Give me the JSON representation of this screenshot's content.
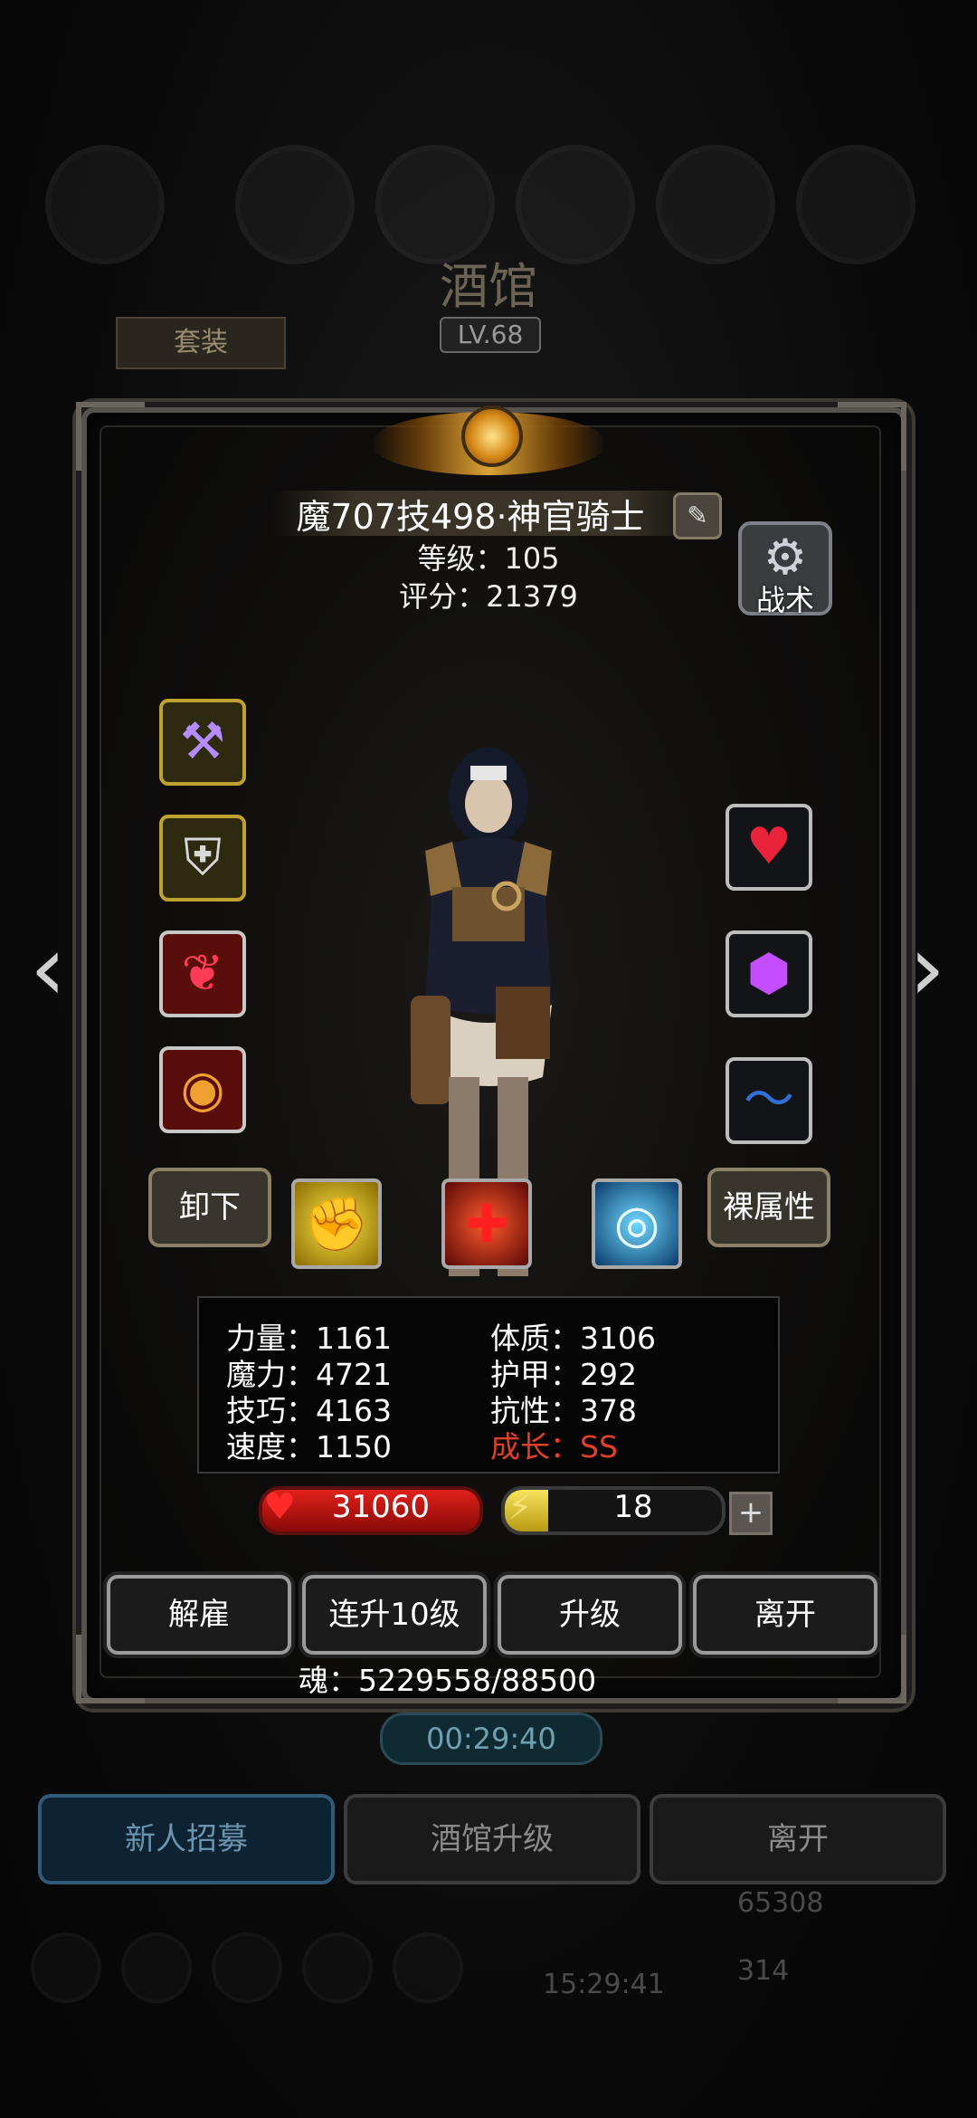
{
  "background": {
    "title": "酒馆",
    "level": "LV.68",
    "tag_button": "套装",
    "timer": "00:29:40",
    "bottom_buttons": [
      "新人招募",
      "酒馆升级",
      "离开"
    ],
    "gold": "65308",
    "gems": "314",
    "clock": "15:29:41"
  },
  "hero": {
    "name": "魔707技498·神官骑士",
    "level_text": "等级：105",
    "score_text": "评分：21379",
    "tactic_label": "战术"
  },
  "equipment": {
    "left_slots": [
      "mace-icon",
      "armor-icon",
      "ruby-amulet-icon",
      "eye-ring-icon"
    ],
    "right_slots": [
      "heart-charm-icon",
      "purple-gem-icon",
      "blue-swoosh-icon"
    ]
  },
  "buttons": {
    "unequip": "卸下",
    "bare_attributes": "裸属性",
    "dismiss": "解雇",
    "level_up_10": "连升10级",
    "level_up": "升级",
    "leave": "离开"
  },
  "skills": [
    "fist-skill-icon",
    "red-cross-skill-icon",
    "eye-skill-icon"
  ],
  "stats": {
    "strength": "力量：1161",
    "magic": "魔力：4721",
    "skill": "技巧：4163",
    "speed": "速度：1150",
    "constitution": "体质：3106",
    "armor": "护甲：292",
    "resistance": "抗性：378",
    "growth": "成长：SS"
  },
  "bars": {
    "hp": "31060",
    "energy": "18",
    "energy_fraction": 0.2
  },
  "soul_text": "魂：5229558/88500",
  "colors": {
    "gold_border": "#bfa32e",
    "hp_red": "#e1201b",
    "energy_yellow": "#f8e45c",
    "growth_red": "#e0402a"
  }
}
